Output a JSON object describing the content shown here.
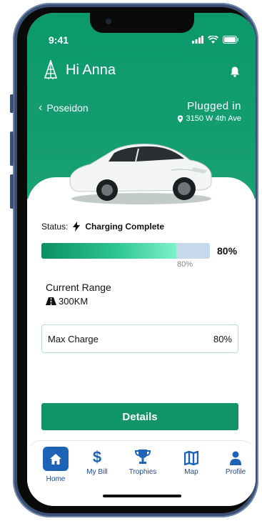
{
  "status_bar": {
    "time": "9:41"
  },
  "header": {
    "greeting": "Hi Anna"
  },
  "vehicle": {
    "back_label": "Poseidon",
    "plug_status": "Plugged in",
    "address": "3150 W 4th Ave"
  },
  "charging": {
    "status_label": "Status:",
    "status_value": "Charging Complete",
    "progress_fraction": 0.8,
    "progress_percent_label": "80%",
    "progress_caption": "80%"
  },
  "range": {
    "label": "Current Range",
    "value": "300KM"
  },
  "max_charge": {
    "label": "Max Charge",
    "value": "80%"
  },
  "details_button": {
    "label": "Details"
  },
  "tabs": [
    {
      "label": "Home",
      "icon": "home-icon",
      "active": true
    },
    {
      "label": "My Bill",
      "icon": "dollar-icon",
      "active": false
    },
    {
      "label": "Trophies",
      "icon": "trophy-icon",
      "active": false
    },
    {
      "label": "Map",
      "icon": "map-icon",
      "active": false
    },
    {
      "label": "Profile",
      "icon": "person-icon",
      "active": false
    }
  ],
  "colors": {
    "primary_green": "#129566",
    "active_tab": "#1c63b5",
    "tab_label": "#1c4a8c",
    "phone_frame": "#3a4f72"
  }
}
